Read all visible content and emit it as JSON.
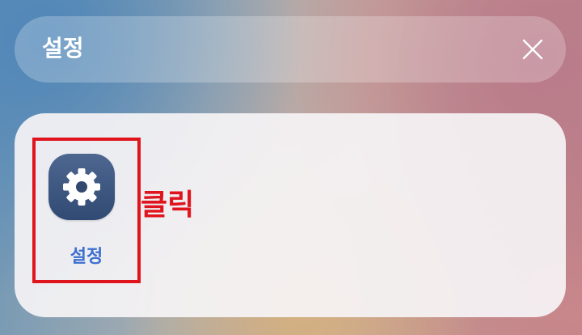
{
  "search": {
    "query": "설정",
    "clear_icon": "close-icon"
  },
  "results": {
    "apps": [
      {
        "label": "설정",
        "icon": "gear-icon",
        "icon_background": "#38507a",
        "label_color": "#3d6fd0"
      }
    ]
  },
  "annotation": {
    "text": "클릭",
    "color": "#e0141d"
  }
}
